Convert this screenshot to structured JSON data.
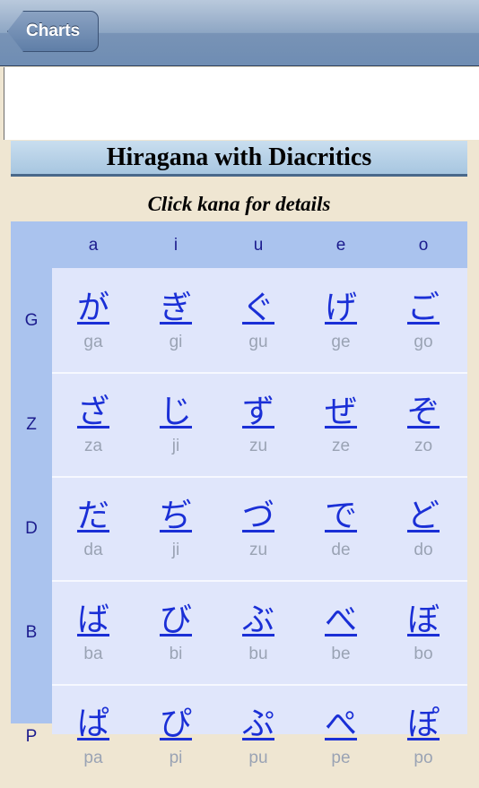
{
  "nav": {
    "back_label": "Charts"
  },
  "title": "Hiragana with Diacritics",
  "subtitle": "Click kana for details",
  "columns": [
    "a",
    "i",
    "u",
    "e",
    "o"
  ],
  "rows": [
    {
      "label": "G",
      "kana": [
        "が",
        "ぎ",
        "ぐ",
        "げ",
        "ご"
      ],
      "romaji": [
        "ga",
        "gi",
        "gu",
        "ge",
        "go"
      ]
    },
    {
      "label": "Z",
      "kana": [
        "ざ",
        "じ",
        "ず",
        "ぜ",
        "ぞ"
      ],
      "romaji": [
        "za",
        "ji",
        "zu",
        "ze",
        "zo"
      ]
    },
    {
      "label": "D",
      "kana": [
        "だ",
        "ぢ",
        "づ",
        "で",
        "ど"
      ],
      "romaji": [
        "da",
        "ji",
        "zu",
        "de",
        "do"
      ]
    },
    {
      "label": "B",
      "kana": [
        "ば",
        "び",
        "ぶ",
        "べ",
        "ぼ"
      ],
      "romaji": [
        "ba",
        "bi",
        "bu",
        "be",
        "bo"
      ]
    },
    {
      "label": "P",
      "kana": [
        "ぱ",
        "ぴ",
        "ぷ",
        "ぺ",
        "ぽ"
      ],
      "romaji": [
        "pa",
        "pi",
        "pu",
        "pe",
        "po"
      ]
    }
  ]
}
